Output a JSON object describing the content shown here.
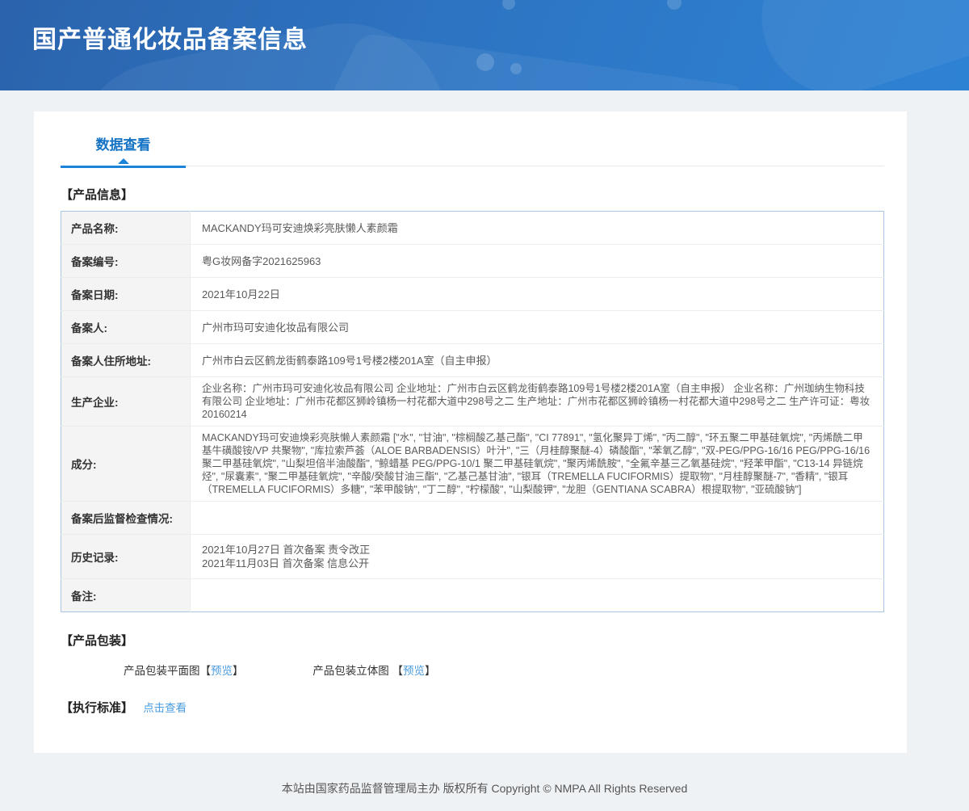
{
  "header": {
    "title": "国产普通化妆品备案信息"
  },
  "tabs": {
    "data_view": "数据查看"
  },
  "sections": {
    "product_info_title": "【产品信息】",
    "packaging_title": "【产品包装】",
    "standard_title": "【执行标准】"
  },
  "product_table": {
    "rows": [
      {
        "label": "产品名称:",
        "value": "MACKANDY玛可安迪焕彩亮肤懒人素颜霜"
      },
      {
        "label": "备案编号:",
        "value": "粤G妆网备字2021625963"
      },
      {
        "label": "备案日期:",
        "value": "2021年10月22日"
      },
      {
        "label": "备案人:",
        "value": "广州市玛可安迪化妆品有限公司"
      },
      {
        "label": "备案人住所地址:",
        "value": "广州市白云区鹤龙街鹤泰路109号1号楼2楼201A室（自主申报）"
      },
      {
        "label": "生产企业:",
        "value": "企业名称：广州市玛可安迪化妆品有限公司 企业地址：广州市白云区鹤龙街鹤泰路109号1号楼2楼201A室（自主申报） 企业名称：广州珈纳生物科技有限公司 企业地址：广州市花都区狮岭镇杨一村花都大道中298号之二 生产地址：广州市花都区狮岭镇杨一村花都大道中298号之二 生产许可证：粤妆20160214",
        "small": true
      },
      {
        "label": "成分:",
        "value": "MACKANDY玛可安迪焕彩亮肤懒人素颜霜 [\"水\", \"甘油\", \"棕榈酸乙基己酯\", \"CI 77891\", \"氢化聚异丁烯\", \"丙二醇\", \"环五聚二甲基硅氧烷\", \"丙烯酰二甲基牛磺酸铵/VP 共聚物\", \"库拉索芦荟（ALOE BARBADENSIS）叶汁\", \"三（月桂醇聚醚-4）磷酸酯\", \"苯氧乙醇\", \"双-PEG/PPG-16/16 PEG/PPG-16/16 聚二甲基硅氧烷\", \"山梨坦倍半油酸酯\", \"鲸蜡基 PEG/PPG-10/1 聚二甲基硅氧烷\", \"聚丙烯酰胺\", \"全氟辛基三乙氧基硅烷\", \"羟苯甲酯\", \"C13-14 异链烷烃\", \"尿囊素\", \"聚二甲基硅氧烷\", \"辛酸/癸酸甘油三酯\", \"乙基己基甘油\", \"银耳（TREMELLA FUCIFORMIS）提取物\", \"月桂醇聚醚-7\", \"香精\", \"银耳（TREMELLA FUCIFORMIS）多糖\", \"苯甲酸钠\", \"丁二醇\", \"柠檬酸\", \"山梨酸钾\", \"龙胆（GENTIANA SCABRA）根提取物\", \"亚硫酸钠\"]",
        "small": true
      },
      {
        "label": "备案后监督检查情况:",
        "value": ""
      },
      {
        "label": "历史记录:",
        "value": "2021年10月27日 首次备案 责令改正\n2021年11月03日 首次备案 信息公开"
      },
      {
        "label": "备注:",
        "value": ""
      }
    ]
  },
  "packaging": {
    "flat_label": "产品包装平面图",
    "stereo_label": "产品包装立体图",
    "bracket_open": "【",
    "bracket_close": "】",
    "preview_label": "预览"
  },
  "standard": {
    "link_label": "点击查看"
  },
  "footer": {
    "text": "本站由国家药品监督管理局主办 版权所有 Copyright © NMPA All Rights Reserved"
  },
  "colors": {
    "header_gradient_start": "#2b63ac",
    "header_gradient_end": "#2e82d4",
    "tab_blue": "#1473c4",
    "tab_underline": "#1b83d8",
    "link_blue": "#4a9ce0",
    "table_border": "#a9c7e4",
    "label_cell_bg": "#f4f4f4",
    "page_bg": "#eff2f5"
  }
}
